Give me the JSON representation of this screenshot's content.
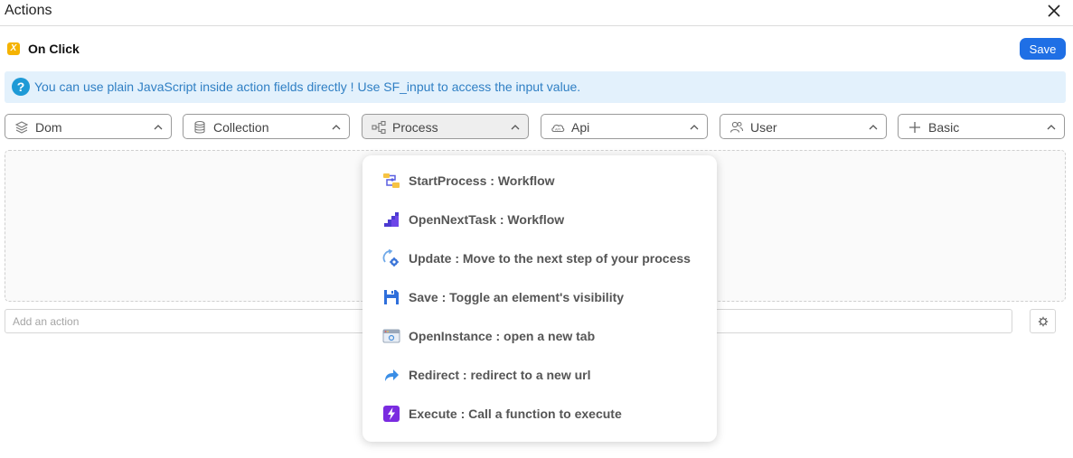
{
  "window": {
    "title": "Actions",
    "close_icon": "close-icon"
  },
  "event": {
    "badge_glyph": "X",
    "badge_color": "#f5b301",
    "label": "On Click"
  },
  "toolbar": {
    "save_label": "Save",
    "accent": "#1f6fe5"
  },
  "info_banner": {
    "icon": "question-circle-icon",
    "text": "You can use plain JavaScript inside action fields directly ! Use SF_input to access the input value.",
    "background": "#e3f1fc",
    "text_color": "#2f7fc4"
  },
  "categories": [
    {
      "label": "Dom",
      "icon": "layers-icon",
      "active": false
    },
    {
      "label": "Collection",
      "icon": "database-icon",
      "active": false
    },
    {
      "label": "Process",
      "icon": "workflow-icon",
      "active": true
    },
    {
      "label": "Api",
      "icon": "cloud-api-icon",
      "active": false
    },
    {
      "label": "User",
      "icon": "users-icon",
      "active": false
    },
    {
      "label": "Basic",
      "icon": "plus-icon",
      "active": false
    }
  ],
  "add_action": {
    "placeholder": "Add an action"
  },
  "process_menu": {
    "items": [
      {
        "label": "StartProcess : Workflow",
        "icon": "start-process-icon"
      },
      {
        "label": "OpenNextTask : Workflow",
        "icon": "next-task-icon"
      },
      {
        "label": "Update : Move to the next step of your process",
        "icon": "update-gear-icon"
      },
      {
        "label": "Save : Toggle an element's visibility",
        "icon": "save-floppy-icon"
      },
      {
        "label": "OpenInstance : open a new tab",
        "icon": "browser-window-icon"
      },
      {
        "label": "Redirect : redirect to a new url",
        "icon": "redirect-arrow-icon"
      },
      {
        "label": "Execute : Call a function to execute",
        "icon": "lightning-icon"
      }
    ]
  }
}
